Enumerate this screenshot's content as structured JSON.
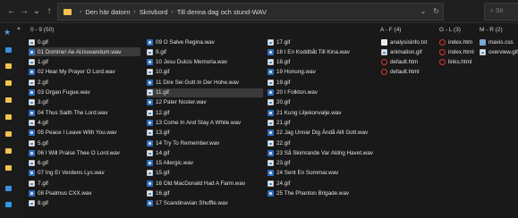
{
  "nav": {
    "back": "←",
    "forward": "→",
    "up": "↑",
    "recent": "⌄"
  },
  "breadcrumb": [
    "Den här datorn",
    "Skrivbord",
    "Till denna dag och stund-WAV"
  ],
  "address_controls": {
    "dropdown": "⌄",
    "refresh": "↻"
  },
  "search": {
    "placeholder": "Sö"
  },
  "groups": [
    {
      "label": "0 - 9 (50)"
    },
    {
      "label": "A - F (4)"
    },
    {
      "label": "G - L (3)"
    },
    {
      "label": "M - R (2)"
    }
  ],
  "files": {
    "col1": [
      {
        "name": "0.gif",
        "type": "gif"
      },
      {
        "name": "01 Domine! Ae AUxuvandum.wav",
        "type": "wav",
        "selected": true
      },
      {
        "name": "1.gif",
        "type": "gif"
      },
      {
        "name": "02 Hear My Prayer O Lord.wav",
        "type": "wav"
      },
      {
        "name": "2.gif",
        "type": "gif"
      },
      {
        "name": "03 Organ Fugue.wav",
        "type": "wav"
      },
      {
        "name": "3.gif",
        "type": "gif"
      },
      {
        "name": "04 Thus Saith The Lord.wav",
        "type": "wav"
      },
      {
        "name": "4.gif",
        "type": "gif"
      },
      {
        "name": "05 Peace I Leave With You.wav",
        "type": "wav"
      },
      {
        "name": "5.gif",
        "type": "gif"
      },
      {
        "name": "06 I Will Praise Thee O Lord.wav",
        "type": "wav"
      },
      {
        "name": "6.gif",
        "type": "gif"
      },
      {
        "name": "07 Ing Er Verdens Lys.wav",
        "type": "wav"
      },
      {
        "name": "7.gif",
        "type": "gif"
      },
      {
        "name": "08 Psalmus CXX.wav",
        "type": "wav"
      },
      {
        "name": "8.gif",
        "type": "gif"
      }
    ],
    "col2": [
      {
        "name": "09 O Salve Regina.wav",
        "type": "wav"
      },
      {
        "name": "9.gif",
        "type": "gif"
      },
      {
        "name": "10 Jesu Dulcis Memoria.wav",
        "type": "wav"
      },
      {
        "name": "10.gif",
        "type": "gif"
      },
      {
        "name": "11 Dire Sei Gott In Der Hohe.wav",
        "type": "wav"
      },
      {
        "name": "11.gif",
        "type": "gif",
        "selected": true
      },
      {
        "name": "12 Pater Noster.wav",
        "type": "wav"
      },
      {
        "name": "12.gif",
        "type": "gif"
      },
      {
        "name": "13 Come In And Stay A While.wav",
        "type": "wav"
      },
      {
        "name": "13.gif",
        "type": "gif"
      },
      {
        "name": "14 Try To Remember.wav",
        "type": "wav"
      },
      {
        "name": "14.gif",
        "type": "gif"
      },
      {
        "name": "15 Allergic.wav",
        "type": "wav"
      },
      {
        "name": "15.gif",
        "type": "gif"
      },
      {
        "name": "16 Old MacDonald Had A Farm.wav",
        "type": "wav"
      },
      {
        "name": "16.gif",
        "type": "gif"
      },
      {
        "name": "17 Scandinavian Shuffle.wav",
        "type": "wav"
      }
    ],
    "col3": [
      {
        "name": "17.gif",
        "type": "gif"
      },
      {
        "name": "18 I En Koddbåt Till Kina.wav",
        "type": "wav"
      },
      {
        "name": "18.gif",
        "type": "gif"
      },
      {
        "name": "19 Honung.wav",
        "type": "wav"
      },
      {
        "name": "19.gif",
        "type": "gif"
      },
      {
        "name": "20 I Folkton.wav",
        "type": "wav"
      },
      {
        "name": "20.gif",
        "type": "gif"
      },
      {
        "name": "21 Kung Liljekonvalje.wav",
        "type": "wav"
      },
      {
        "name": "21.gif",
        "type": "gif"
      },
      {
        "name": "22 Jag Unnar Dig Ändå Allt Gott.wav",
        "type": "wav"
      },
      {
        "name": "22.gif",
        "type": "gif"
      },
      {
        "name": "23 Så Skimrande Var Aldrig Havet.wav",
        "type": "wav"
      },
      {
        "name": "23.gif",
        "type": "gif"
      },
      {
        "name": "24 Sent En Sommar.wav",
        "type": "wav"
      },
      {
        "name": "24.gif",
        "type": "gif"
      },
      {
        "name": "25 The Phanton Brigade.wav",
        "type": "wav"
      }
    ],
    "colAF": [
      {
        "name": "analysisinfo.txt",
        "type": "file"
      },
      {
        "name": "animation.gif",
        "type": "gif"
      },
      {
        "name": "default.htm",
        "type": "html"
      },
      {
        "name": "default.html",
        "type": "html"
      }
    ],
    "colGL": [
      {
        "name": "index.htm",
        "type": "html"
      },
      {
        "name": "index.html",
        "type": "html"
      },
      {
        "name": "links.html",
        "type": "html"
      }
    ],
    "colMR": [
      {
        "name": "mavis.css",
        "type": "css"
      },
      {
        "name": "overview.gif",
        "type": "gif"
      }
    ]
  },
  "colors": {
    "background": "#191919",
    "selected": "#3a3a3a",
    "folder": "#f3c24f",
    "wav": "#2d6fc4",
    "html": "#e0332f"
  }
}
